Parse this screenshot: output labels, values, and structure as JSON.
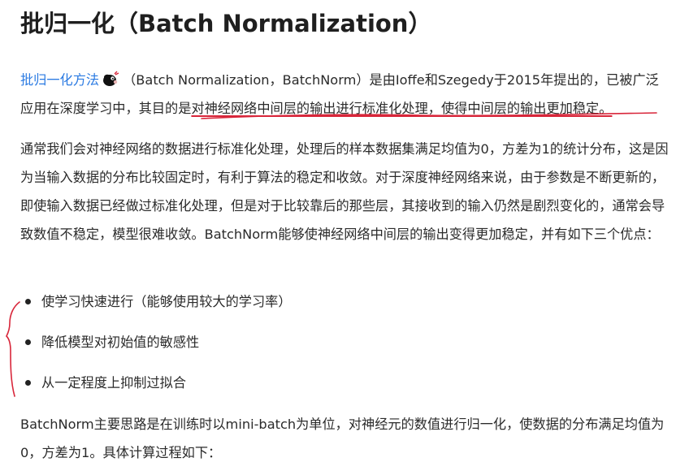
{
  "title": "批归一化（Batch Normalization）",
  "intro": {
    "link_text": "批归一化方法",
    "avatar_icon": "avatar-icon",
    "part1": "（Batch Normalization，BatchNorm）是由Ioffe和Szegedy于2015年提出的，已被广泛应用在深度学习中，其目的是",
    "highlight": "对神经网络中间层的输出进行标准化处理，使得中间层的输出更加稳定。"
  },
  "paragraph2": "通常我们会对神经网络的数据进行标准化处理，处理后的样本数据集满足均值为0，方差为1的统计分布，这是因为当输入数据的分布比较固定时，有利于算法的稳定和收敛。对于深度神经网络来说，由于参数是不断更新的，即使输入数据已经做过标准化处理，但是对于比较靠后的那些层，其接收到的输入仍然是剧烈变化的，通常会导致数值不稳定，模型很难收敛。BatchNorm能够使神经网络中间层的输出变得更加稳定，并有如下三个优点：",
  "advantages": [
    "使学习快速进行（能够使用较大的学习率）",
    "降低模型对初始值的敏感性",
    "从一定程度上抑制过拟合"
  ],
  "paragraph3": "BatchNorm主要思路是在训练时以mini-batch为单位，对神经元的数值进行归一化，使数据的分布满足均值为0，方差为1。具体计算过程如下：",
  "annotation_color": "#d8263a",
  "link_color": "#2a7ae2"
}
